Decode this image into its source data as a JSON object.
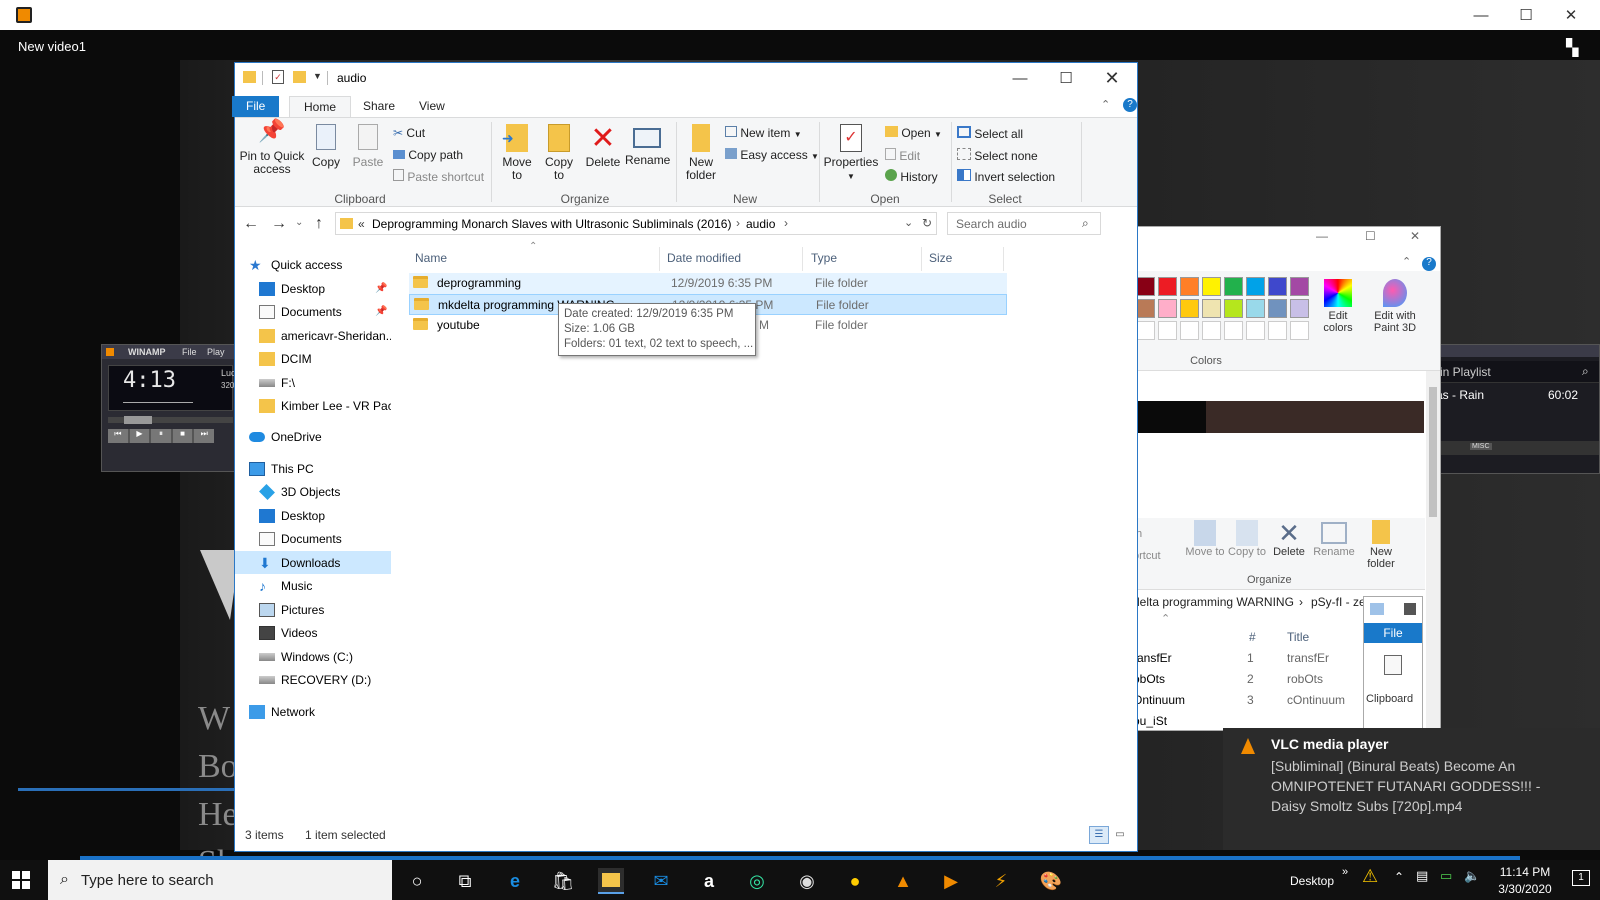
{
  "vlc": {
    "title": "New video1",
    "video_text": [
      "W",
      "Bo",
      "He",
      "Sk"
    ]
  },
  "winamp": {
    "title": "WINAMP",
    "menu": [
      "File",
      "Play"
    ],
    "time": "4:13",
    "track_partial": "Luc",
    "bitrate_partial": "320",
    "playlist_title_partial": "n in Playlist",
    "playlist_item_partial": "tias - Rain",
    "playlist_item_time": "60:02",
    "misc_label": "MISC"
  },
  "paint": {
    "colors_label": "Colors",
    "edit_colors": "Edit colors",
    "edit_3d": "Edit with Paint 3D",
    "palette_row1": [
      "#880015",
      "#ed1c24",
      "#ff7f27",
      "#fff200",
      "#22b14c",
      "#00a2e8",
      "#3f48cc",
      "#a349a4"
    ],
    "palette_row2": [
      "#b97a57",
      "#ffaec9",
      "#ffc90e",
      "#efe4b0",
      "#b5e61d",
      "#99d9ea",
      "#7092be",
      "#c8bfe7"
    ]
  },
  "back_explorer": {
    "ribbon": {
      "move_to": "Move to",
      "copy_to": "Copy to",
      "delete": "Delete",
      "rename": "Rename",
      "new_folder": "New folder",
      "group_organize": "Organize",
      "partial_th": "th",
      "partial_ortcut": "ortcut"
    },
    "path_partial": "delta programming WARNING",
    "path_partial2": "pSy-fI - zerO One",
    "columns": {
      "num": "#",
      "title": "Title"
    },
    "rows": [
      {
        "name": "ransfEr",
        "num": "1",
        "title": "transfEr"
      },
      {
        "name": "obOts",
        "num": "2",
        "title": "robOts"
      },
      {
        "name": "Ontinuum",
        "num": "3",
        "title": "cOntinuum"
      },
      {
        "name": "ou_iSt",
        "num": "",
        "title": ""
      }
    ],
    "mini": {
      "file": "File",
      "clipboard": "Clipboard"
    }
  },
  "explorer": {
    "title": "audio",
    "tabs": [
      "File",
      "Home",
      "Share",
      "View"
    ],
    "clipboard": {
      "pin": "Pin to Quick access",
      "copy": "Copy",
      "paste": "Paste",
      "cut": "Cut",
      "copy_path": "Copy path",
      "paste_shortcut": "Paste shortcut",
      "label": "Clipboard"
    },
    "organize": {
      "move_to": "Move to",
      "copy_to": "Copy to",
      "delete": "Delete",
      "rename": "Rename",
      "label": "Organize"
    },
    "new": {
      "new_folder": "New folder",
      "new_item": "New item",
      "easy_access": "Easy access",
      "label": "New"
    },
    "open": {
      "properties": "Properties",
      "open": "Open",
      "edit": "Edit",
      "history": "History",
      "label": "Open"
    },
    "select": {
      "select_all": "Select all",
      "select_none": "Select none",
      "invert": "Invert selection",
      "label": "Select"
    },
    "address": {
      "prefix": "«",
      "crumb1": "Deprogramming Monarch Slaves with Ultrasonic Subliminals (2016)",
      "crumb2": "audio"
    },
    "search_placeholder": "Search audio",
    "nav": [
      {
        "label": "Quick access",
        "icon": "star-icon",
        "pin": false
      },
      {
        "label": "Desktop",
        "icon": "desktop-icon",
        "pin": true
      },
      {
        "label": "Documents",
        "icon": "documents-icon",
        "pin": true
      },
      {
        "label": "americavr-Sheridan...",
        "icon": "folder-icon",
        "pin": false
      },
      {
        "label": "DCIM",
        "icon": "folder-icon",
        "pin": false
      },
      {
        "label": "F:\\",
        "icon": "drive-icon",
        "pin": false
      },
      {
        "label": "Kimber Lee - VR Pac",
        "icon": "folder-icon",
        "pin": false
      },
      {
        "label": "OneDrive",
        "icon": "cloud-icon",
        "pin": false
      },
      {
        "label": "This PC",
        "icon": "pc-icon",
        "pin": false
      },
      {
        "label": "3D Objects",
        "icon": "cube-icon",
        "pin": false
      },
      {
        "label": "Desktop",
        "icon": "desktop-icon",
        "pin": false
      },
      {
        "label": "Documents",
        "icon": "documents-icon",
        "pin": false
      },
      {
        "label": "Downloads",
        "icon": "download-icon",
        "pin": false
      },
      {
        "label": "Music",
        "icon": "music-icon",
        "pin": false
      },
      {
        "label": "Pictures",
        "icon": "pictures-icon",
        "pin": false
      },
      {
        "label": "Videos",
        "icon": "videos-icon",
        "pin": false
      },
      {
        "label": "Windows (C:)",
        "icon": "drive-icon",
        "pin": false
      },
      {
        "label": "RECOVERY (D:)",
        "icon": "drive-icon",
        "pin": false
      },
      {
        "label": "Network",
        "icon": "network-icon",
        "pin": false
      }
    ],
    "columns": {
      "name": "Name",
      "date": "Date modified",
      "type": "Type",
      "size": "Size"
    },
    "files": [
      {
        "name": "deprogramming",
        "date": "12/9/2019 6:35 PM",
        "type": "File folder",
        "state": "hover"
      },
      {
        "name": "mkdelta programming WARNING",
        "date": "12/9/2019 6:35 PM",
        "type": "File folder",
        "state": "selected"
      },
      {
        "name": "youtube",
        "date": "M",
        "type": "File folder",
        "state": ""
      }
    ],
    "tooltip": {
      "line1": "Date created: 12/9/2019 6:35 PM",
      "line2": "Size: 1.06 GB",
      "line3": "Folders: 01 text, 02 text to speech, ..."
    },
    "status": {
      "items": "3 items",
      "selected": "1 item selected"
    }
  },
  "toast": {
    "app": "VLC media player",
    "message": "[Subliminal] (Binural Beats) Become An OMNIPOTENET FUTANARI GODDESS!!! - Daisy Smoltz Subs [720p].mp4"
  },
  "taskbar": {
    "search_placeholder": "Type here to search",
    "desktop_label": "Desktop",
    "time": "11:14 PM",
    "date": "3/30/2020",
    "notification_count": "1"
  }
}
